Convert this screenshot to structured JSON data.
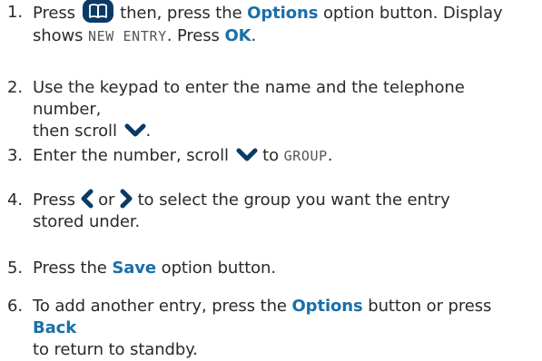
{
  "colors": {
    "text": "#2a2a2a",
    "keyword": "#1a6fa8",
    "icon_fill": "#0a3a67"
  },
  "icons": {
    "phonebook": "phonebook-button-icon",
    "down": "chevron-down-icon",
    "left": "chevron-left-icon",
    "right": "chevron-right-icon"
  },
  "steps": [
    {
      "num": "1.",
      "t1": "Press",
      "t2": "then, press the",
      "kw1": "Options",
      "t3": "option button. Display",
      "t4": "shows",
      "lcd": "NEW ENTRY",
      "t5": ". Press",
      "kw2": "OK",
      "t6": "."
    },
    {
      "num": "2.",
      "t1": "Use the keypad to enter the name and the telephone number,",
      "t2": "then scroll",
      "t3": "."
    },
    {
      "num": "3.",
      "t1": "Enter the number, scroll",
      "t2": "to",
      "lcd": "GROUP",
      "t3": "."
    },
    {
      "num": "4.",
      "t1": "Press",
      "t2": "or",
      "t3": "to select the group you want the entry",
      "t4": "stored under."
    },
    {
      "num": "5.",
      "t1": "Press the",
      "kw1": "Save",
      "t2": "option button."
    },
    {
      "num": "6.",
      "t1": "To add another entry, press the",
      "kw1": "Options",
      "t2": "button or press",
      "kw2": "Back",
      "t3": "to return to standby."
    }
  ]
}
